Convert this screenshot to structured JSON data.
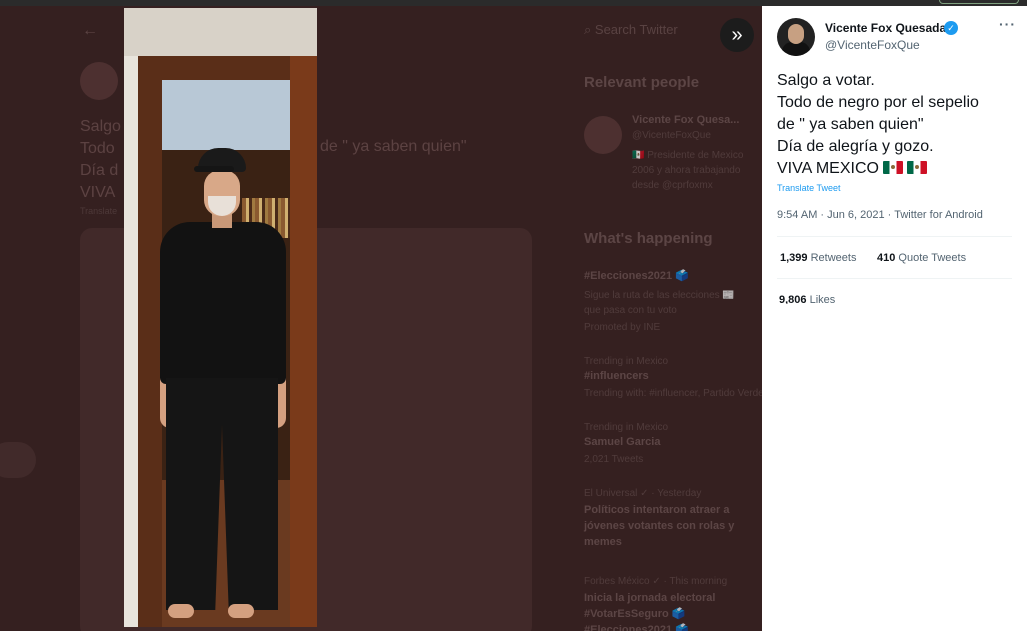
{
  "background": {
    "search_placeholder": "Search Twitter",
    "tweet_text_lines": [
      "Salgo",
      "Todo",
      "Día d",
      "VIVA"
    ],
    "tweet_text_fragment": "de \" ya saben quien\"",
    "translate_label": "Translate",
    "relevant_people_heading": "Relevant people",
    "relevant_person_name": "Vicente Fox Quesa...",
    "relevant_person_handle": "@VicenteFoxQue",
    "relevant_person_bio": "🇲🇽 Presidente de Mexico\n2006 y ahora trabajando\ndesde @cprfoxmx",
    "whats_happening_heading": "What's happening",
    "trend1_title": "#Elecciones2021 🗳️",
    "trend1_desc": "Sigue la ruta de las elecciones 📰\nque pasa con tu voto",
    "trend1_promo": "Promoted by INE",
    "trend2_context": "Trending in Mexico",
    "trend2_title": "#influencers",
    "trend2_sub": "Trending with: #influencer, Partido Verde",
    "trend3_context": "Trending in Mexico",
    "trend3_title": "Samuel Garcia",
    "trend3_count": "2,021 Tweets",
    "news1_source": "El Universal ✓ · Yesterday",
    "news1_title": "Políticos intentaron atraer a\njóvenes votantes con rolas y\nmemes",
    "news2_source": "Forbes México ✓ · This morning",
    "news2_title": "Inicia la jornada electoral\n#VotarEsSeguro 🗳️\n#Elecciones2021 🗳️"
  },
  "tweet": {
    "author_name": "Vicente Fox Quesada",
    "author_handle": "@VicenteFoxQue",
    "more_label": "···",
    "text_lines": [
      "Salgo a votar.",
      "Todo de negro por el sepelio",
      "de \" ya saben quien\"",
      "Día de alegría y gozo.",
      "VIVA MEXICO"
    ],
    "translate_label": "Translate Tweet",
    "meta": "9:54 AM · Jun 6, 2021 · Twitter for Android",
    "retweets_count": "1,399",
    "retweets_label": "Retweets",
    "quote_count": "410",
    "quote_label": "Quote Tweets",
    "likes_count": "9,806",
    "likes_label": "Likes"
  },
  "colors": {
    "verified_blue": "#1d9bf0",
    "link_blue": "#1d9bf0",
    "muted_text": "#536471"
  },
  "icons": {
    "expand": "double-chevron-right-icon",
    "verified": "verified-badge-icon",
    "more": "more-horizontal-icon",
    "flag": "mexico-flag-icon"
  }
}
